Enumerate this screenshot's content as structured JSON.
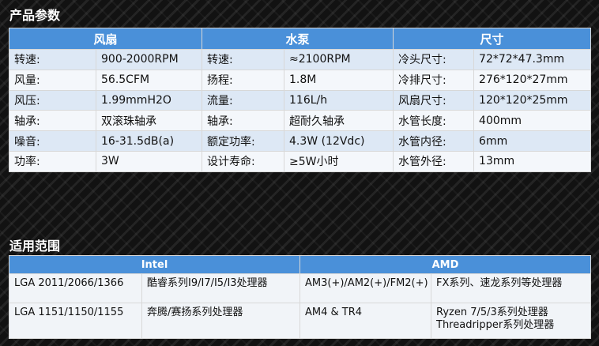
{
  "sections": {
    "params_title": "产品参数",
    "compat_title": "适用范围"
  },
  "params": {
    "headers": [
      "风扇",
      "水泵",
      "尺寸"
    ],
    "rows": [
      [
        "转速:",
        "900-2000RPM",
        "转速:",
        "≈2100RPM",
        "冷头尺寸:",
        "72*72*47.3mm"
      ],
      [
        "风量:",
        "56.5CFM",
        "扬程:",
        "1.8M",
        "冷排尺寸:",
        "276*120*27mm"
      ],
      [
        "风压:",
        "1.99mmH2O",
        "流量:",
        "116L/h",
        "风扇尺寸:",
        "120*120*25mm"
      ],
      [
        "轴承:",
        "双滚珠轴承",
        "轴承:",
        "超耐久轴承",
        "水管长度:",
        "400mm"
      ],
      [
        "噪音:",
        "16-31.5dB(a)",
        "额定功率:",
        "4.3W (12Vdc)",
        "水管内径:",
        "6mm"
      ],
      [
        "功率:",
        "3W",
        "设计寿命:",
        "≥5W小时",
        "水管外径:",
        "13mm"
      ]
    ]
  },
  "compat": {
    "headers": [
      "Intel",
      "AMD"
    ],
    "rows": [
      [
        "LGA 2011/2066/1366",
        "酷睿系列I9/I7/I5/I3处理器",
        "AM3(+)/AM2(+)/FM2(+)",
        "FX系列、速龙系列等处理器",
        ""
      ],
      [
        "LGA 1151/1150/1155",
        "奔腾/赛扬系列处理器",
        "AM4 & TR4",
        "Ryzen 7/5/3系列处理器",
        "Threadripper系列处理器"
      ]
    ]
  }
}
